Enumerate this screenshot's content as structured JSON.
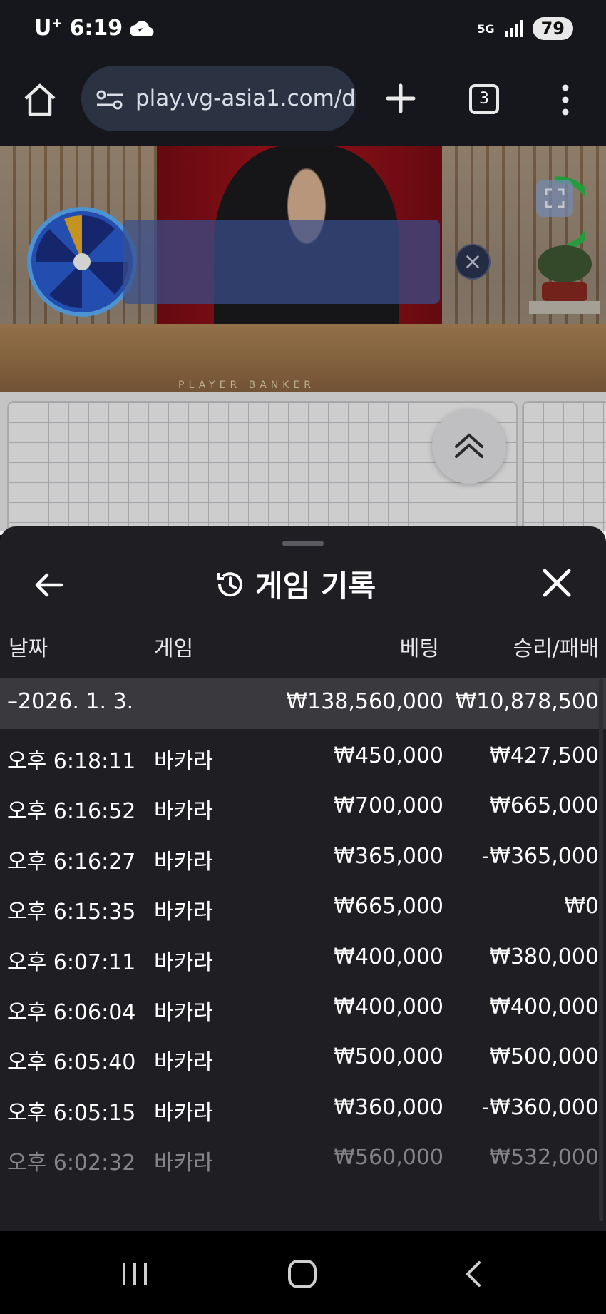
{
  "status_bar": {
    "carrier": "U",
    "carrier_sup": "+",
    "time": "6:19",
    "network": "5G",
    "battery": "79"
  },
  "browser": {
    "url": "play.vg-asia1.com/d",
    "tab_count": "3"
  },
  "video": {
    "table_labels": "PLAYER      BANKER"
  },
  "sheet": {
    "title": "게임 기록",
    "columns": {
      "date": "날짜",
      "game": "게임",
      "bet": "베팅",
      "win_loss": "승리/패배"
    },
    "date_group": {
      "date": "–2026. 1. 3.",
      "bet_total": "₩138,560,000",
      "win_total": "₩10,878,500"
    },
    "rows": [
      {
        "time": "오후 6:18:11",
        "game": "바카라",
        "bet": "₩450,000",
        "win": "₩427,500"
      },
      {
        "time": "오후 6:16:52",
        "game": "바카라",
        "bet": "₩700,000",
        "win": "₩665,000"
      },
      {
        "time": "오후 6:16:27",
        "game": "바카라",
        "bet": "₩365,000",
        "win": "-₩365,000"
      },
      {
        "time": "오후 6:15:35",
        "game": "바카라",
        "bet": "₩665,000",
        "win": "₩0"
      },
      {
        "time": "오후 6:07:11",
        "game": "바카라",
        "bet": "₩400,000",
        "win": "₩380,000"
      },
      {
        "time": "오후 6:06:04",
        "game": "바카라",
        "bet": "₩400,000",
        "win": "₩400,000"
      },
      {
        "time": "오후 6:05:40",
        "game": "바카라",
        "bet": "₩500,000",
        "win": "₩500,000"
      },
      {
        "time": "오후 6:05:15",
        "game": "바카라",
        "bet": "₩360,000",
        "win": "-₩360,000"
      },
      {
        "time": "오후 6:02:32",
        "game": "바카라",
        "bet": "₩560,000",
        "win": "₩532,000"
      }
    ]
  },
  "icons": {
    "home": "home-icon",
    "site_settings": "tune-icon",
    "new_tab": "plus-icon",
    "tabs": "tabs-icon",
    "menu": "more-vert-icon",
    "back": "arrow-left-icon",
    "history": "history-icon",
    "close": "close-icon",
    "collapse": "chevron-up-double-icon"
  }
}
